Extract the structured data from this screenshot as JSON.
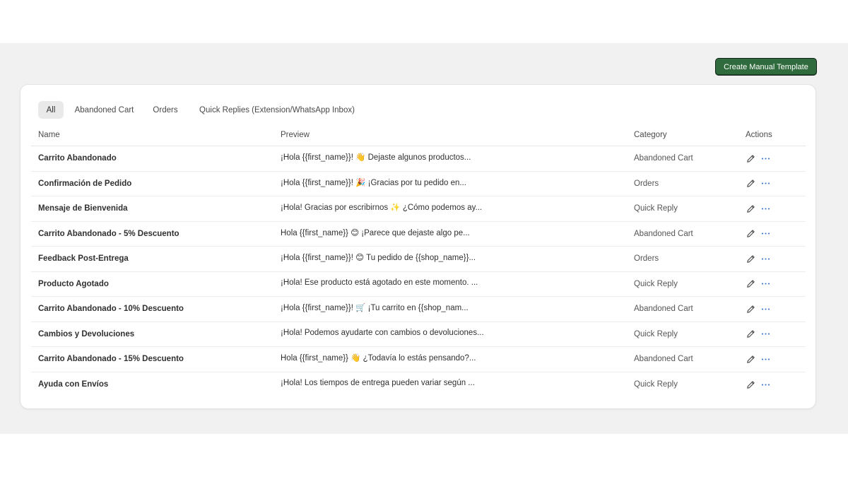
{
  "toolbar": {
    "create_label": "Create Manual Template"
  },
  "tabs": [
    {
      "label": "All",
      "active": true
    },
    {
      "label": "Abandoned Cart",
      "active": false
    },
    {
      "label": "Orders",
      "active": false
    },
    {
      "label": "Quick Replies (Extension/WhatsApp Inbox)",
      "active": false
    }
  ],
  "table": {
    "headers": {
      "name": "Name",
      "preview": "Preview",
      "category": "Category",
      "actions": "Actions"
    },
    "rows": [
      {
        "name": "Carrito Abandonado",
        "preview": "¡Hola {{first_name}}! 👋 Dejaste algunos productos...",
        "category": "Abandoned Cart"
      },
      {
        "name": "Confirmación de Pedido",
        "preview": "¡Hola {{first_name}}! 🎉 ¡Gracias por tu pedido en...",
        "category": "Orders"
      },
      {
        "name": "Mensaje de Bienvenida",
        "preview": "¡Hola! Gracias por escribirnos ✨ ¿Cómo podemos ay...",
        "category": "Quick Reply"
      },
      {
        "name": "Carrito Abandonado - 5% Descuento",
        "preview": "Hola {{first_name}} 😊 ¡Parece que dejaste algo pe...",
        "category": "Abandoned Cart"
      },
      {
        "name": "Feedback Post-Entrega",
        "preview": "¡Hola {{first_name}}! 😊 Tu pedido de {{shop_name}}...",
        "category": "Orders"
      },
      {
        "name": "Producto Agotado",
        "preview": "¡Hola! Ese producto está agotado en este momento. ...",
        "category": "Quick Reply"
      },
      {
        "name": "Carrito Abandonado - 10% Descuento",
        "preview": "¡Hola {{first_name}}! 🛒 ¡Tu carrito en {{shop_nam...",
        "category": "Abandoned Cart"
      },
      {
        "name": "Cambios y Devoluciones",
        "preview": "¡Hola! Podemos ayudarte con cambios o devoluciones...",
        "category": "Quick Reply"
      },
      {
        "name": "Carrito Abandonado - 15% Descuento",
        "preview": "Hola {{first_name}} 👋 ¿Todavía lo estás pensando?...",
        "category": "Abandoned Cart"
      },
      {
        "name": "Ayuda con Envíos",
        "preview": "¡Hola! Los tiempos de entrega pueden variar según ...",
        "category": "Quick Reply"
      }
    ]
  },
  "icons": {
    "edit": "pencil-icon",
    "more": "more-horizontal-icon"
  },
  "colors": {
    "primary_button": "#2f6b3c",
    "more_icon": "#2c6ecb"
  }
}
